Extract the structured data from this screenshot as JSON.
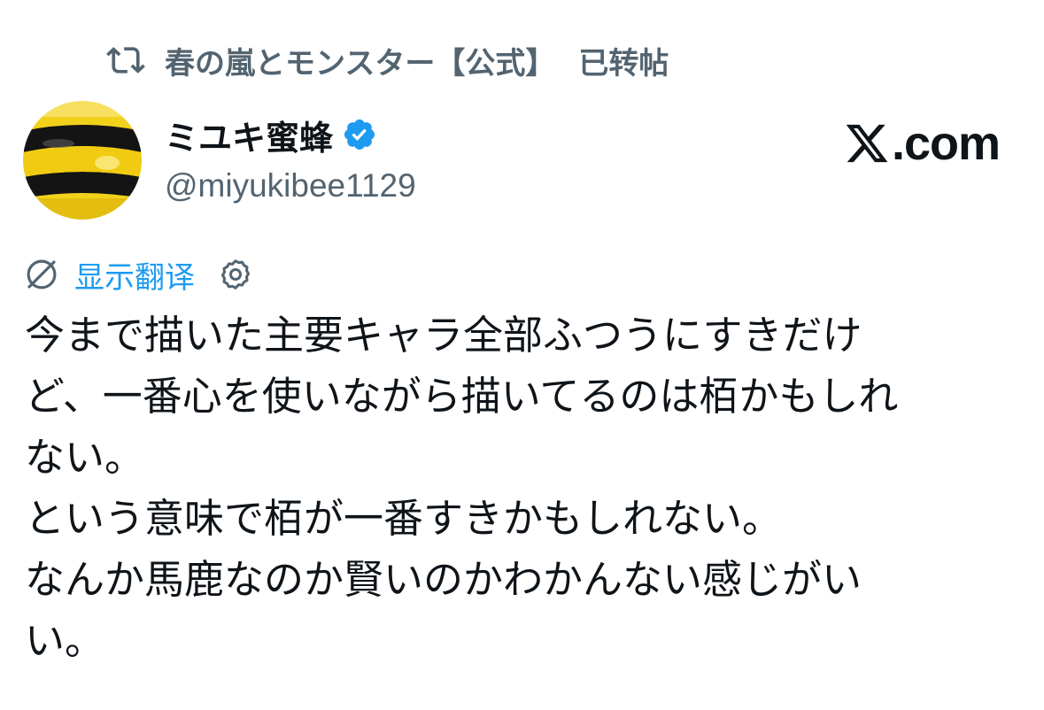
{
  "repost": {
    "icon": "repost-icon",
    "reposter": "春の嵐とモンスター【公式】",
    "label": "已转帖"
  },
  "author": {
    "avatar": "avatar",
    "display_name": "ミユキ蜜蜂",
    "verified_icon": "verified-badge-icon",
    "handle": "@miyukibee1129"
  },
  "brand": {
    "logo": "x-logo-icon",
    "suffix": ".com"
  },
  "translate": {
    "icon": "translate-globe-icon",
    "label": "显示翻译",
    "settings_icon": "gear-icon"
  },
  "tweet": {
    "lines": [
      "今まで描いた主要キャラ全部ふつうにすきだけ",
      "ど、一番心を使いながら描いてるのは栢かもしれ",
      "ない。",
      "という意味で栢が一番すきかもしれない。",
      "なんか馬鹿なのか賢いのかわかんない感じがい",
      "い。"
    ]
  },
  "colors": {
    "text_primary": "#0f1419",
    "text_secondary": "#536471",
    "link": "#1d9bf0",
    "verified": "#1d9bf0",
    "avatar_yellow": "#f2d11b",
    "avatar_black": "#141414"
  }
}
